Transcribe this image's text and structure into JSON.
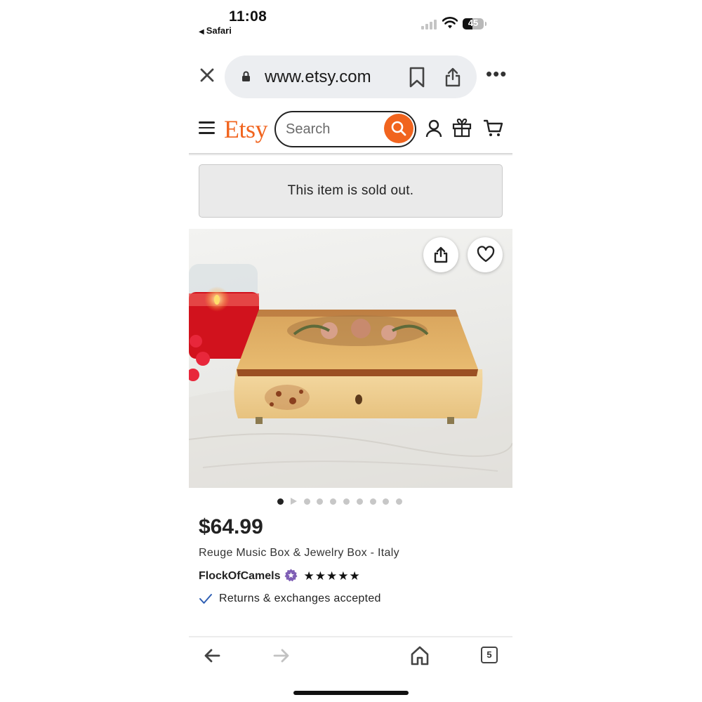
{
  "status_bar": {
    "time": "11:08",
    "back_app": "Safari",
    "battery": "45"
  },
  "browser": {
    "url": "www.etsy.com",
    "tab_count": "5"
  },
  "etsy_header": {
    "logo": "Etsy",
    "search_placeholder": "Search",
    "brand_color": "#f1641e"
  },
  "listing": {
    "sold_out_message": "This item is sold out.",
    "image_count": 10,
    "active_image_index": 0,
    "price": "$64.99",
    "title": "Reuge Music Box & Jewelry Box - Italy",
    "shop_name": "FlockOfCamels",
    "star_seller_badge_color": "#7f5fb5",
    "rating_stars": "★★★★★",
    "rating_value": 5,
    "returns_text": "Returns & exchanges accepted"
  },
  "icons": {
    "close": "close-icon",
    "lock": "lock-icon",
    "bookmark": "bookmark-icon",
    "share": "share-icon",
    "more": "more-icon",
    "menu": "hamburger-icon",
    "search": "search-icon",
    "account": "account-icon",
    "gift": "gift-icon",
    "cart": "cart-icon",
    "favorite": "heart-icon",
    "back": "arrow-left-icon",
    "forward": "arrow-right-icon",
    "home": "home-icon"
  }
}
